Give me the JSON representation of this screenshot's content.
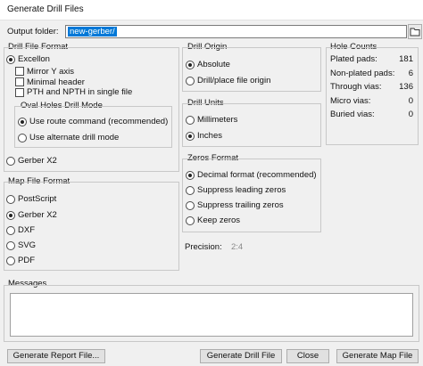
{
  "window": {
    "title": "Generate Drill Files"
  },
  "output": {
    "label": "Output folder:",
    "value": "new-gerber/"
  },
  "drill_file_format": {
    "title": "Drill File Format",
    "excellon_label": "Excellon",
    "excellon_selected": true,
    "options": [
      {
        "label": "Mirror Y axis",
        "checked": false
      },
      {
        "label": "Minimal header",
        "checked": false
      },
      {
        "label": "PTH and NPTH in single file",
        "checked": false
      }
    ],
    "oval": {
      "title": "Oval Holes Drill Mode",
      "route_label": "Use route command (recommended)",
      "alt_label": "Use alternate drill mode"
    },
    "gerber_label": "Gerber X2"
  },
  "map_file_format": {
    "title": "Map File Format",
    "options": [
      {
        "label": "PostScript",
        "selected": false
      },
      {
        "label": "Gerber X2",
        "selected": true
      },
      {
        "label": "DXF",
        "selected": false
      },
      {
        "label": "SVG",
        "selected": false
      },
      {
        "label": "PDF",
        "selected": false
      }
    ]
  },
  "drill_origin": {
    "title": "Drill Origin",
    "options": [
      {
        "label": "Absolute",
        "selected": true
      },
      {
        "label": "Drill/place file origin",
        "selected": false
      }
    ]
  },
  "drill_units": {
    "title": "Drill Units",
    "options": [
      {
        "label": "Millimeters",
        "selected": false
      },
      {
        "label": "Inches",
        "selected": true
      }
    ]
  },
  "zeros_format": {
    "title": "Zeros Format",
    "options": [
      {
        "label": "Decimal format (recommended)",
        "selected": true
      },
      {
        "label": "Suppress leading zeros",
        "selected": false
      },
      {
        "label": "Suppress trailing zeros",
        "selected": false
      },
      {
        "label": "Keep zeros",
        "selected": false
      }
    ]
  },
  "precision": {
    "label": "Precision:",
    "value": "2:4"
  },
  "hole_counts": {
    "title": "Hole Counts",
    "rows": [
      {
        "label": "Plated pads:",
        "value": "181"
      },
      {
        "label": "Non-plated pads:",
        "value": "6"
      },
      {
        "label": "Through vias:",
        "value": "136"
      },
      {
        "label": "Micro vias:",
        "value": "0"
      },
      {
        "label": "Buried vias:",
        "value": "0"
      }
    ]
  },
  "messages": {
    "title": "Messages"
  },
  "buttons": {
    "report": "Generate Report File...",
    "drill": "Generate Drill File",
    "close": "Close",
    "map": "Generate Map File"
  },
  "colors": {
    "selection": "#0078d7",
    "background": "#f0f0f0"
  },
  "icons": {
    "folder": "folder-icon"
  }
}
